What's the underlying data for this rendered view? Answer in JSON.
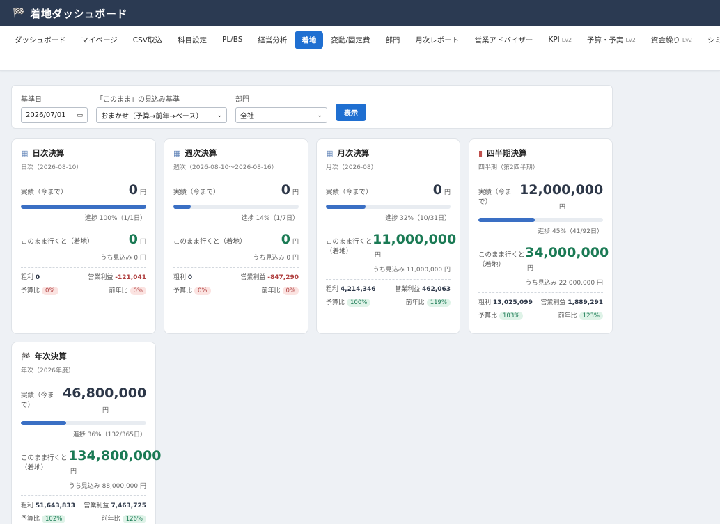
{
  "app": {
    "title": "着地ダッシュボード",
    "icon": "checkered-flag-icon"
  },
  "nav": {
    "tabs": [
      {
        "label": "ダッシュボード",
        "lv": ""
      },
      {
        "label": "マイページ",
        "lv": ""
      },
      {
        "label": "CSV取込",
        "lv": ""
      },
      {
        "label": "科目設定",
        "lv": ""
      },
      {
        "label": "PL/BS",
        "lv": ""
      },
      {
        "label": "経営分析",
        "lv": ""
      },
      {
        "label": "着地",
        "lv": ""
      },
      {
        "label": "変動/固定費",
        "lv": ""
      },
      {
        "label": "部門",
        "lv": ""
      },
      {
        "label": "月次レポート",
        "lv": ""
      },
      {
        "label": "営業アドバイザー",
        "lv": ""
      },
      {
        "label": "KPI",
        "lv": "Lv2"
      },
      {
        "label": "予算・予実",
        "lv": "Lv2"
      },
      {
        "label": "資金繰り",
        "lv": "Lv2"
      },
      {
        "label": "シミュ",
        "lv": ""
      }
    ],
    "active_index": 6
  },
  "filter": {
    "date_label": "基準日",
    "date_value": "2026/07/01",
    "basis_label": "「このまま」の見込み基準",
    "basis_value": "おまかせ（予算→前年→ペース）",
    "dept_label": "部門",
    "dept_value": "全社",
    "show_button": "表示"
  },
  "cards": [
    {
      "icon": "calendar-icon",
      "title": "日次決算",
      "sub": "日次（2026-08-10）",
      "actual_label": "実績（今まで）",
      "actual": "0",
      "yen": "円",
      "progress": 100,
      "progress_text": "進捗 100%（1/1日）",
      "landing_label": "このまま行くと（着地）",
      "landing": "0",
      "forecast_text": "うち見込み 0 円",
      "gross_label": "粗利",
      "gross": "0",
      "op_label": "営業利益",
      "op": "-121,041",
      "budget_label": "予算比",
      "budget": "0%",
      "yoy_label": "前年比",
      "yoy": "0%"
    },
    {
      "icon": "calendar-icon",
      "title": "週次決算",
      "sub": "週次（2026-08-10〜2026-08-16）",
      "actual_label": "実績（今まで）",
      "actual": "0",
      "yen": "円",
      "progress": 14,
      "progress_text": "進捗 14%（1/7日）",
      "landing_label": "このまま行くと（着地）",
      "landing": "0",
      "forecast_text": "うち見込み 0 円",
      "gross_label": "粗利",
      "gross": "0",
      "op_label": "営業利益",
      "op": "-847,290",
      "budget_label": "予算比",
      "budget": "0%",
      "yoy_label": "前年比",
      "yoy": "0%"
    },
    {
      "icon": "calendar-icon",
      "title": "月次決算",
      "sub": "月次（2026-08）",
      "actual_label": "実績（今まで）",
      "actual": "0",
      "yen": "円",
      "progress": 32,
      "progress_text": "進捗 32%（10/31日）",
      "landing_label": "このまま行くと（着地）",
      "landing": "11,000,000",
      "forecast_text": "うち見込み 11,000,000 円",
      "gross_label": "粗利",
      "gross": "4,214,346",
      "op_label": "営業利益",
      "op": "462,063",
      "budget_label": "予算比",
      "budget": "100%",
      "yoy_label": "前年比",
      "yoy": "119%"
    },
    {
      "icon": "bar-chart-icon",
      "title": "四半期決算",
      "sub": "四半期（第2四半期）",
      "actual_label": "実績（今まで）",
      "actual": "12,000,000",
      "yen": "円",
      "progress": 45,
      "progress_text": "進捗 45%（41/92日）",
      "landing_label": "このまま行くと（着地）",
      "landing": "34,000,000",
      "forecast_text": "うち見込み 22,000,000 円",
      "gross_label": "粗利",
      "gross": "13,025,099",
      "op_label": "営業利益",
      "op": "1,889,291",
      "budget_label": "予算比",
      "budget": "103%",
      "yoy_label": "前年比",
      "yoy": "123%"
    },
    {
      "icon": "checkered-flag-icon",
      "title": "年次決算",
      "sub": "年次（2026年度）",
      "actual_label": "実績（今まで）",
      "actual": "46,800,000",
      "yen": "円",
      "progress": 36,
      "progress_text": "進捗 36%（132/365日）",
      "landing_label": "このまま行くと（着地）",
      "landing": "134,800,000",
      "forecast_text": "うち見込み 88,000,000 円",
      "gross_label": "粗利",
      "gross": "51,643,833",
      "op_label": "営業利益",
      "op": "7,463,725",
      "budget_label": "予算比",
      "budget": "102%",
      "yoy_label": "前年比",
      "yoy": "126%"
    }
  ]
}
